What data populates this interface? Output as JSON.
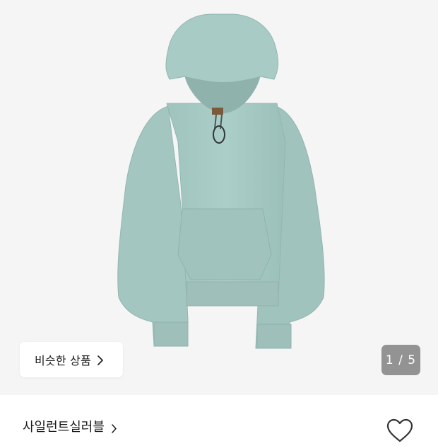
{
  "gallery": {
    "image": "product-hoodie",
    "hoodie_color": "#a6c9c3",
    "similar_button": {
      "label": "비슷한 상품",
      "icon": "chevron-right-icon"
    },
    "counter": {
      "text": "1 / 5",
      "current": 1,
      "total": 5
    }
  },
  "product": {
    "brand": "사일런트실러블",
    "brand_icon": "chevron-right-icon",
    "like_icon": "heart-outline-icon"
  }
}
